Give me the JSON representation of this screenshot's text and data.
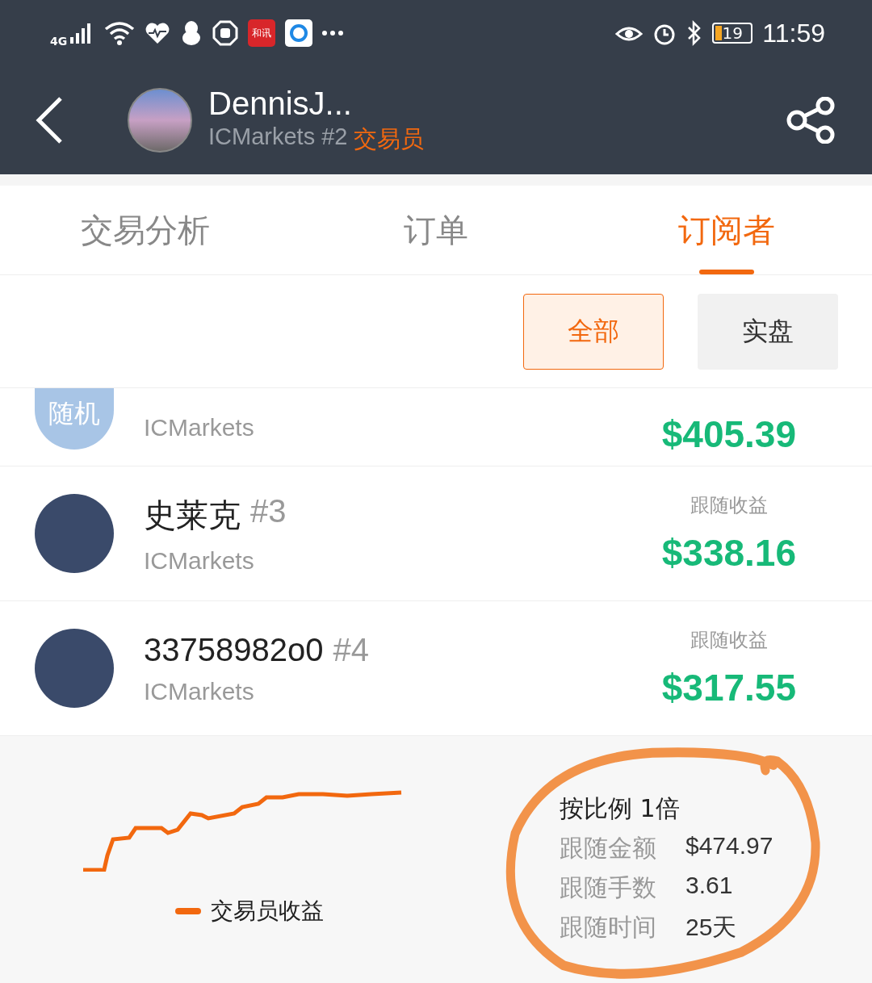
{
  "status_bar": {
    "network": "4G",
    "battery": "19",
    "time": "11:59",
    "app_badge": "和讯"
  },
  "header": {
    "name": "DennisJ...",
    "broker": "ICMarkets #2",
    "role": "交易员"
  },
  "tabs": [
    {
      "label": "交易分析",
      "selected": false
    },
    {
      "label": "订单",
      "selected": false
    },
    {
      "label": "订阅者",
      "selected": true
    }
  ],
  "filters": [
    {
      "label": "全部",
      "selected": true
    },
    {
      "label": "实盘",
      "selected": false
    }
  ],
  "subscribers": [
    {
      "kind": "clipped",
      "avatar_text": "随机",
      "broker": "ICMarkets",
      "amount": "$405.39"
    },
    {
      "kind": "full",
      "name": "史莱克",
      "rank": "#3",
      "broker": "ICMarkets",
      "label": "跟随收益",
      "amount": "$338.16"
    },
    {
      "kind": "full",
      "name": "33758982o0",
      "rank": "#4",
      "broker": "ICMarkets",
      "label": "跟随收益",
      "amount": "$317.55"
    }
  ],
  "summary": {
    "legend": "交易员收益",
    "ratio": "按比例 1倍",
    "stats": [
      {
        "label": "跟随金额",
        "value": "$474.97"
      },
      {
        "label": "跟随手数",
        "value": "3.61"
      },
      {
        "label": "跟随时间",
        "value": "25天"
      }
    ]
  }
}
